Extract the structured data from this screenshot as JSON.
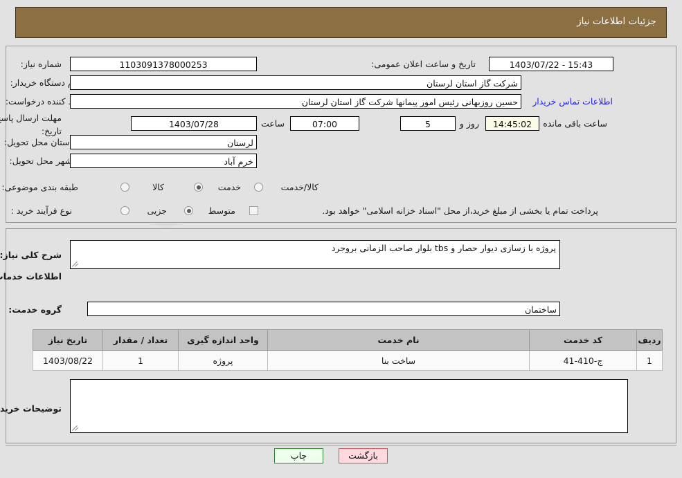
{
  "header": {
    "title": "جزئیات اطلاعات نیاز"
  },
  "watermark": {
    "text": "AnaTender.net"
  },
  "top_form": {
    "need_number": {
      "label": "شماره نیاز:",
      "value": "1103091378000253"
    },
    "public_announce": {
      "label": "تاریخ و ساعت اعلان عمومی:",
      "value": "15:43 - 1403/07/22"
    },
    "buyer_org": {
      "label": "نام دستگاه خریدار:",
      "value": "شرکت گاز استان لرستان"
    },
    "requester": {
      "label": "ایجاد کننده درخواست:",
      "value": "حسین روزبهانی رئیس امور پیمانها شرکت گاز استان لرستان"
    },
    "contact_link": {
      "label": "اطلاعات تماس خریدار"
    },
    "deadline": {
      "label": "مهلت ارسال پاسخ: تا تاریخ:",
      "date": "1403/07/28",
      "hour_label": "ساعت",
      "hour": "07:00",
      "days": "5",
      "days_label": "روز و",
      "countdown": "14:45:02",
      "remaining_label": "ساعت باقی مانده"
    },
    "province": {
      "label": "استان محل تحویل:",
      "value": "لرستان"
    },
    "city": {
      "label": "شهر محل تحویل:",
      "value": "خرم آباد"
    },
    "category": {
      "label": "طبقه بندی موضوعی:",
      "options": [
        "کالا",
        "خدمت",
        "کالا/خدمت"
      ],
      "selected": "خدمت"
    },
    "purchase_type": {
      "label": "نوع فرآیند خرید :",
      "options": [
        "جزیی",
        "متوسط"
      ],
      "selected": "متوسط"
    },
    "treasury_note": {
      "text": "پرداخت تمام یا بخشی از مبلغ خرید،از محل \"اسناد خزانه اسلامی\" خواهد بود.",
      "checked": false
    }
  },
  "bottom": {
    "summary": {
      "label": "شرح کلی نیاز:",
      "value": "پروژه با زسازی دیوار حصار و tbs بلوار صاحب الزمانی بروجرد"
    },
    "services_heading": "اطلاعات خدمات مورد نیاز",
    "service_group": {
      "label": "گروه خدمت:",
      "value": "ساختمان"
    },
    "table": {
      "columns": [
        "ردیف",
        "کد خدمت",
        "نام خدمت",
        "واحد اندازه گیری",
        "تعداد / مقدار",
        "تاریخ نیاز"
      ],
      "rows": [
        {
          "row_no": "1",
          "service_code": "ج-410-41",
          "service_name": "ساخت بنا",
          "unit": "پروژه",
          "quantity": "1",
          "need_date": "1403/08/22"
        }
      ]
    },
    "buyer_notes": {
      "label": "توضیحات خریدار:",
      "value": ""
    }
  },
  "footer": {
    "print_label": "چاپ",
    "back_label": "بازگشت"
  }
}
